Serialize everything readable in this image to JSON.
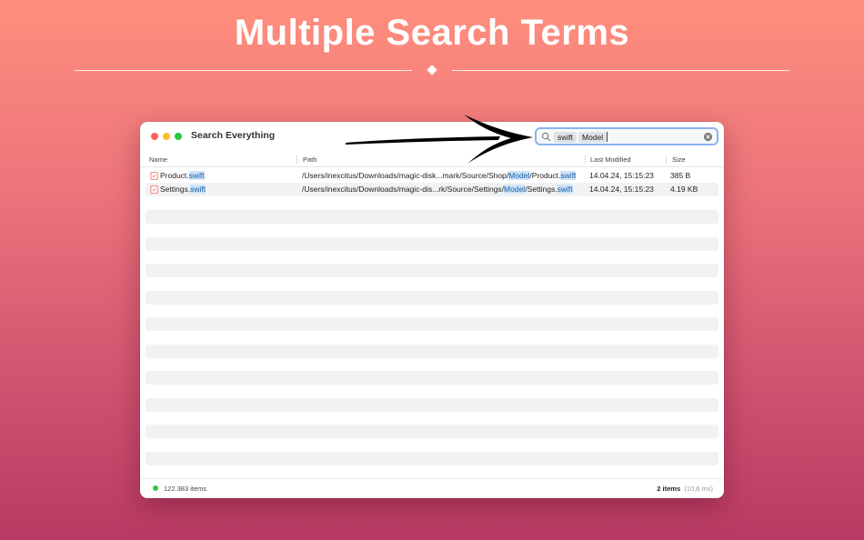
{
  "hero": {
    "title": "Multiple Search Terms"
  },
  "window": {
    "title": "Search Everything"
  },
  "search": {
    "tokens": [
      "swift",
      "Model"
    ]
  },
  "columns": {
    "name": "Name",
    "path": "Path",
    "modified": "Last Modified",
    "size": "Size"
  },
  "results": [
    {
      "name_base": "Product.",
      "name_match": "swift",
      "path_pre": "/Users/inexcitus/Downloads/magic-disk...mark/Source/Shop/",
      "path_match1": "Model",
      "path_mid": "/Product.",
      "path_match2": "swift",
      "modified": "14.04.24, 15:15:23",
      "size": "385 B"
    },
    {
      "name_base": "Settings.",
      "name_match": "swift",
      "path_pre": "/Users/inexcitus/Downloads/magic-dis...rk/Source/Settings/",
      "path_match1": "Model",
      "path_mid": "/Settings.",
      "path_match2": "swift",
      "modified": "14.04.24, 15:15:23",
      "size": "4.19 KB"
    }
  ],
  "status": {
    "indexed": "122.383 items",
    "result_count": "2 items",
    "timing": "(10,6 ms)",
    "indicator_color": "#31c742"
  },
  "icons": {
    "search": "magnifier-icon",
    "clear": "clear-circle-icon",
    "file": "swift-file-icon"
  },
  "colors": {
    "highlight_bg": "#cfe3f7",
    "highlight_text": "#1b5fa8",
    "focus_ring": "#8cb4ee",
    "swift_orange": "#f05138"
  }
}
